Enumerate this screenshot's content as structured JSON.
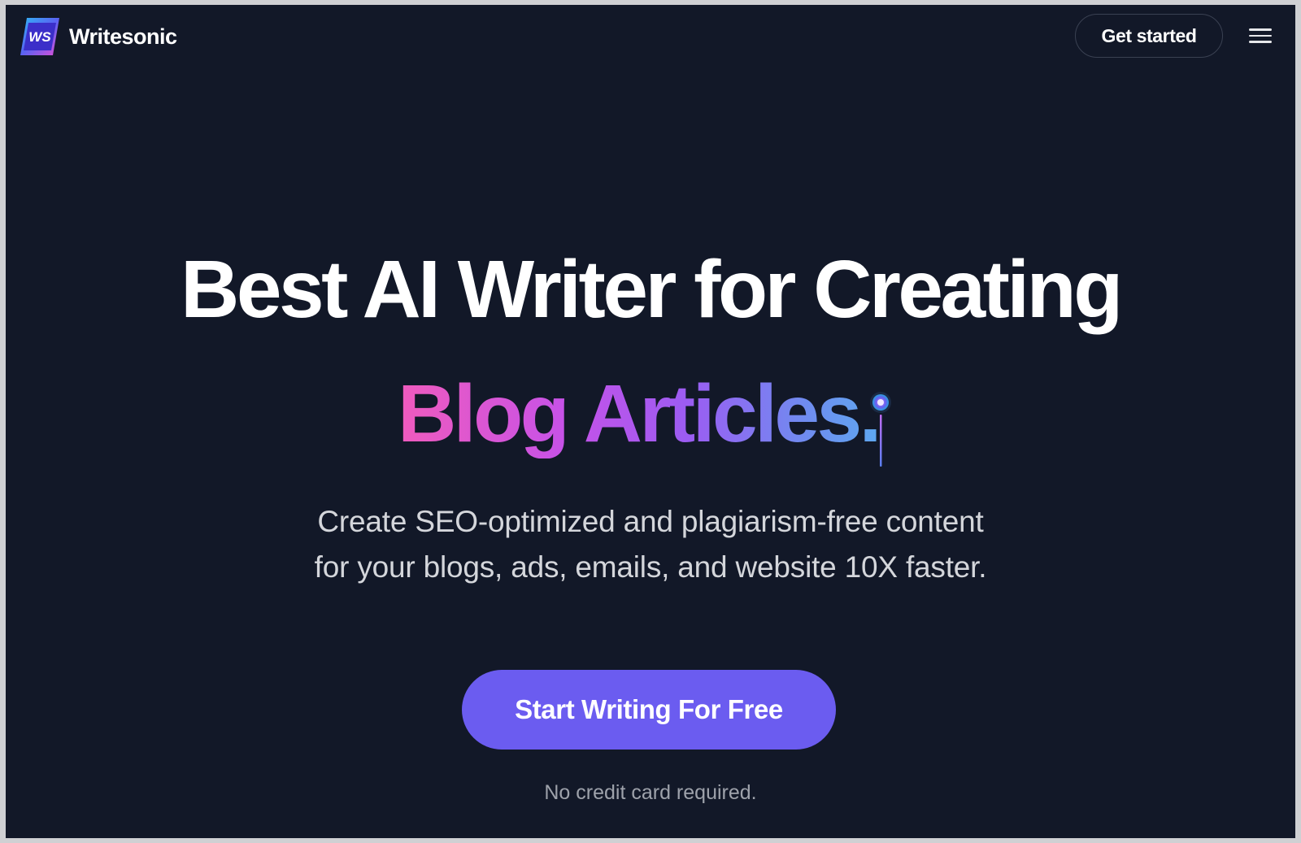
{
  "header": {
    "brand_name": "Writesonic",
    "logo_text": "WS",
    "cta_label": "Get started",
    "menu_icon": "hamburger-menu-icon"
  },
  "hero": {
    "title_line1": "Best AI Writer for Creating",
    "title_line2": "Blog Articles.",
    "subtitle_line1": "Create SEO-optimized and plagiarism-free content",
    "subtitle_line2": "for your blogs, ads, emails, and website 10X faster.",
    "cta_label": "Start Writing For Free",
    "note": "No credit card required."
  },
  "colors": {
    "background": "#121828",
    "cta": "#6b5cf0",
    "gradient_start": "#f05bbd",
    "gradient_end": "#5ea8f0"
  }
}
